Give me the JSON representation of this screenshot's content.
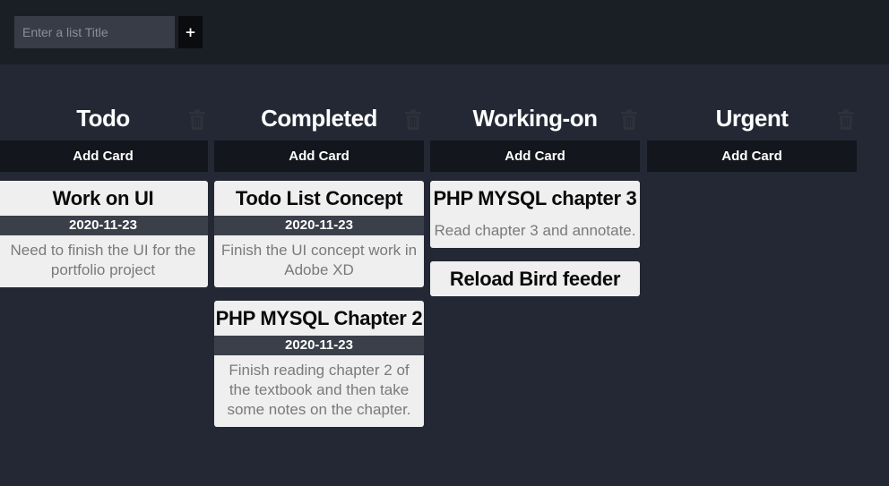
{
  "header": {
    "list_title_placeholder": "Enter a list Title",
    "add_list_label": "+"
  },
  "lists": [
    {
      "title": "Todo",
      "add_card_label": "Add Card",
      "cards": [
        {
          "title": "Work on UI",
          "date": "2020-11-23",
          "description": "Need to finish the UI for the portfolio project"
        }
      ]
    },
    {
      "title": "Completed",
      "add_card_label": "Add Card",
      "cards": [
        {
          "title": "Todo List Concept",
          "date": "2020-11-23",
          "description": "Finish the UI concept work in Adobe XD"
        },
        {
          "title": "PHP MYSQL Chapter 2",
          "date": "2020-11-23",
          "description": "Finish reading chapter 2 of the textbook and then take some notes on the chapter."
        }
      ]
    },
    {
      "title": "Working-on",
      "add_card_label": "Add Card",
      "cards": [
        {
          "title": "PHP MYSQL chapter 3",
          "description": "Read chapter 3 and annotate."
        },
        {
          "title": "Reload Bird feeder"
        }
      ]
    },
    {
      "title": "Urgent",
      "add_card_label": "Add Card",
      "cards": []
    }
  ],
  "icons": {
    "delete_list": "trash-icon"
  },
  "colors": {
    "background": "#232834",
    "topbar": "#1a1e25",
    "card": "#efefef",
    "date_bar": "#3a3f49",
    "add_card_button": "#13161c"
  }
}
